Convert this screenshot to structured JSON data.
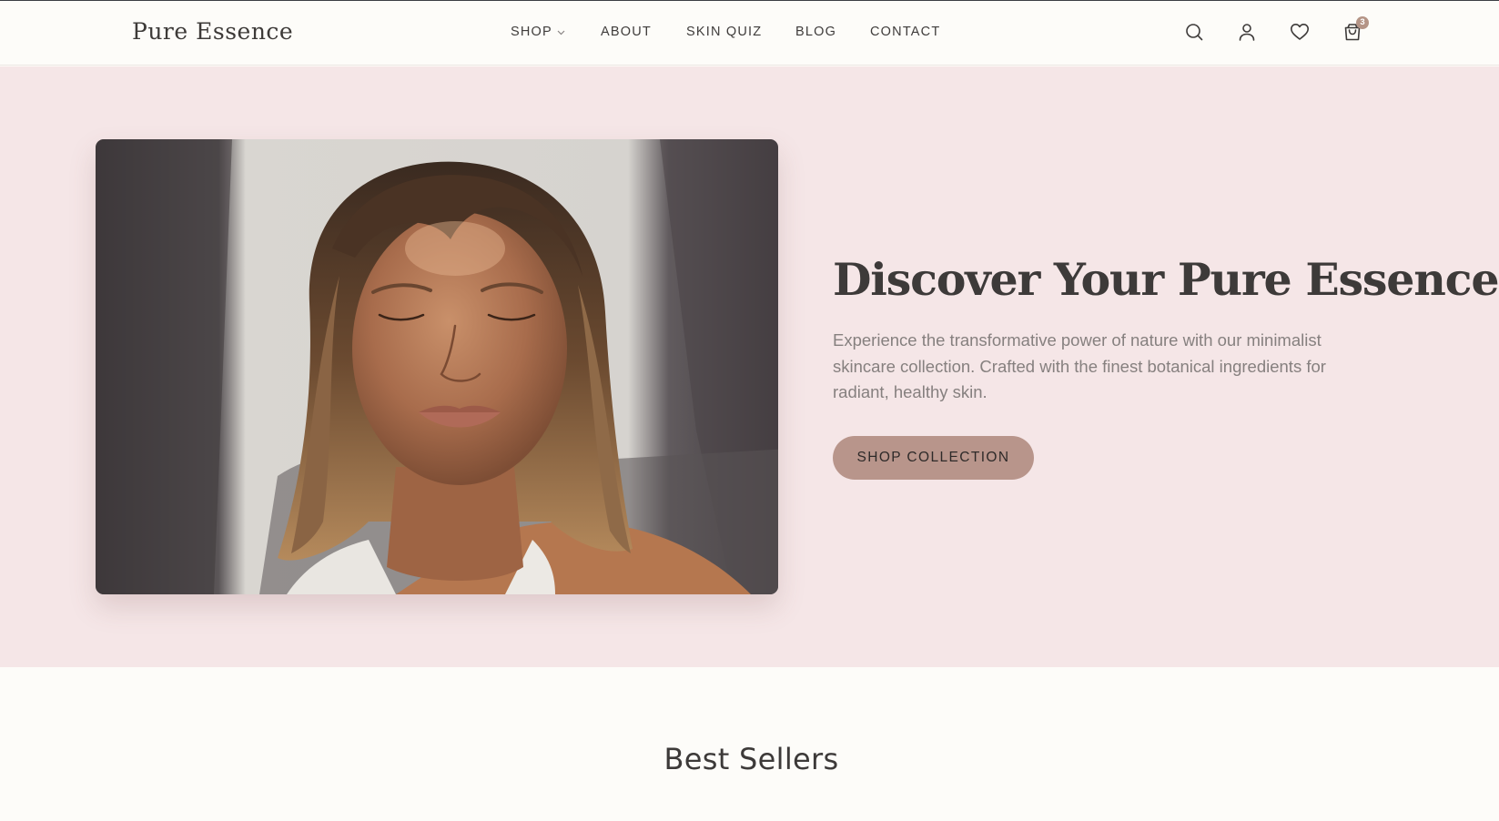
{
  "brand": {
    "logo_text": "Pure Essence"
  },
  "nav": {
    "items": [
      {
        "label": "SHOP",
        "has_dropdown": true
      },
      {
        "label": "ABOUT"
      },
      {
        "label": "SKIN QUIZ"
      },
      {
        "label": "BLOG"
      },
      {
        "label": "CONTACT"
      }
    ]
  },
  "header_icons": {
    "search": "search-icon",
    "account": "user-icon",
    "wishlist": "heart-icon",
    "cart": "shopping-bag-icon",
    "cart_count": "3"
  },
  "hero": {
    "title": "Discover Your Pure Essence",
    "description": "Experience the transformative power of nature with our minimalist skincare collection. Crafted with the finest botanical ingredients for radiant, healthy skin.",
    "cta_label": "SHOP COLLECTION",
    "image_subject": "woman-portrait-photo"
  },
  "best_sellers": {
    "title": "Best Sellers"
  },
  "colors": {
    "page_bg": "#fdfcf9",
    "hero_bg": "#f5e6e7",
    "accent": "#b8958b",
    "text": "#3d3a39",
    "muted_text": "#86807f"
  }
}
